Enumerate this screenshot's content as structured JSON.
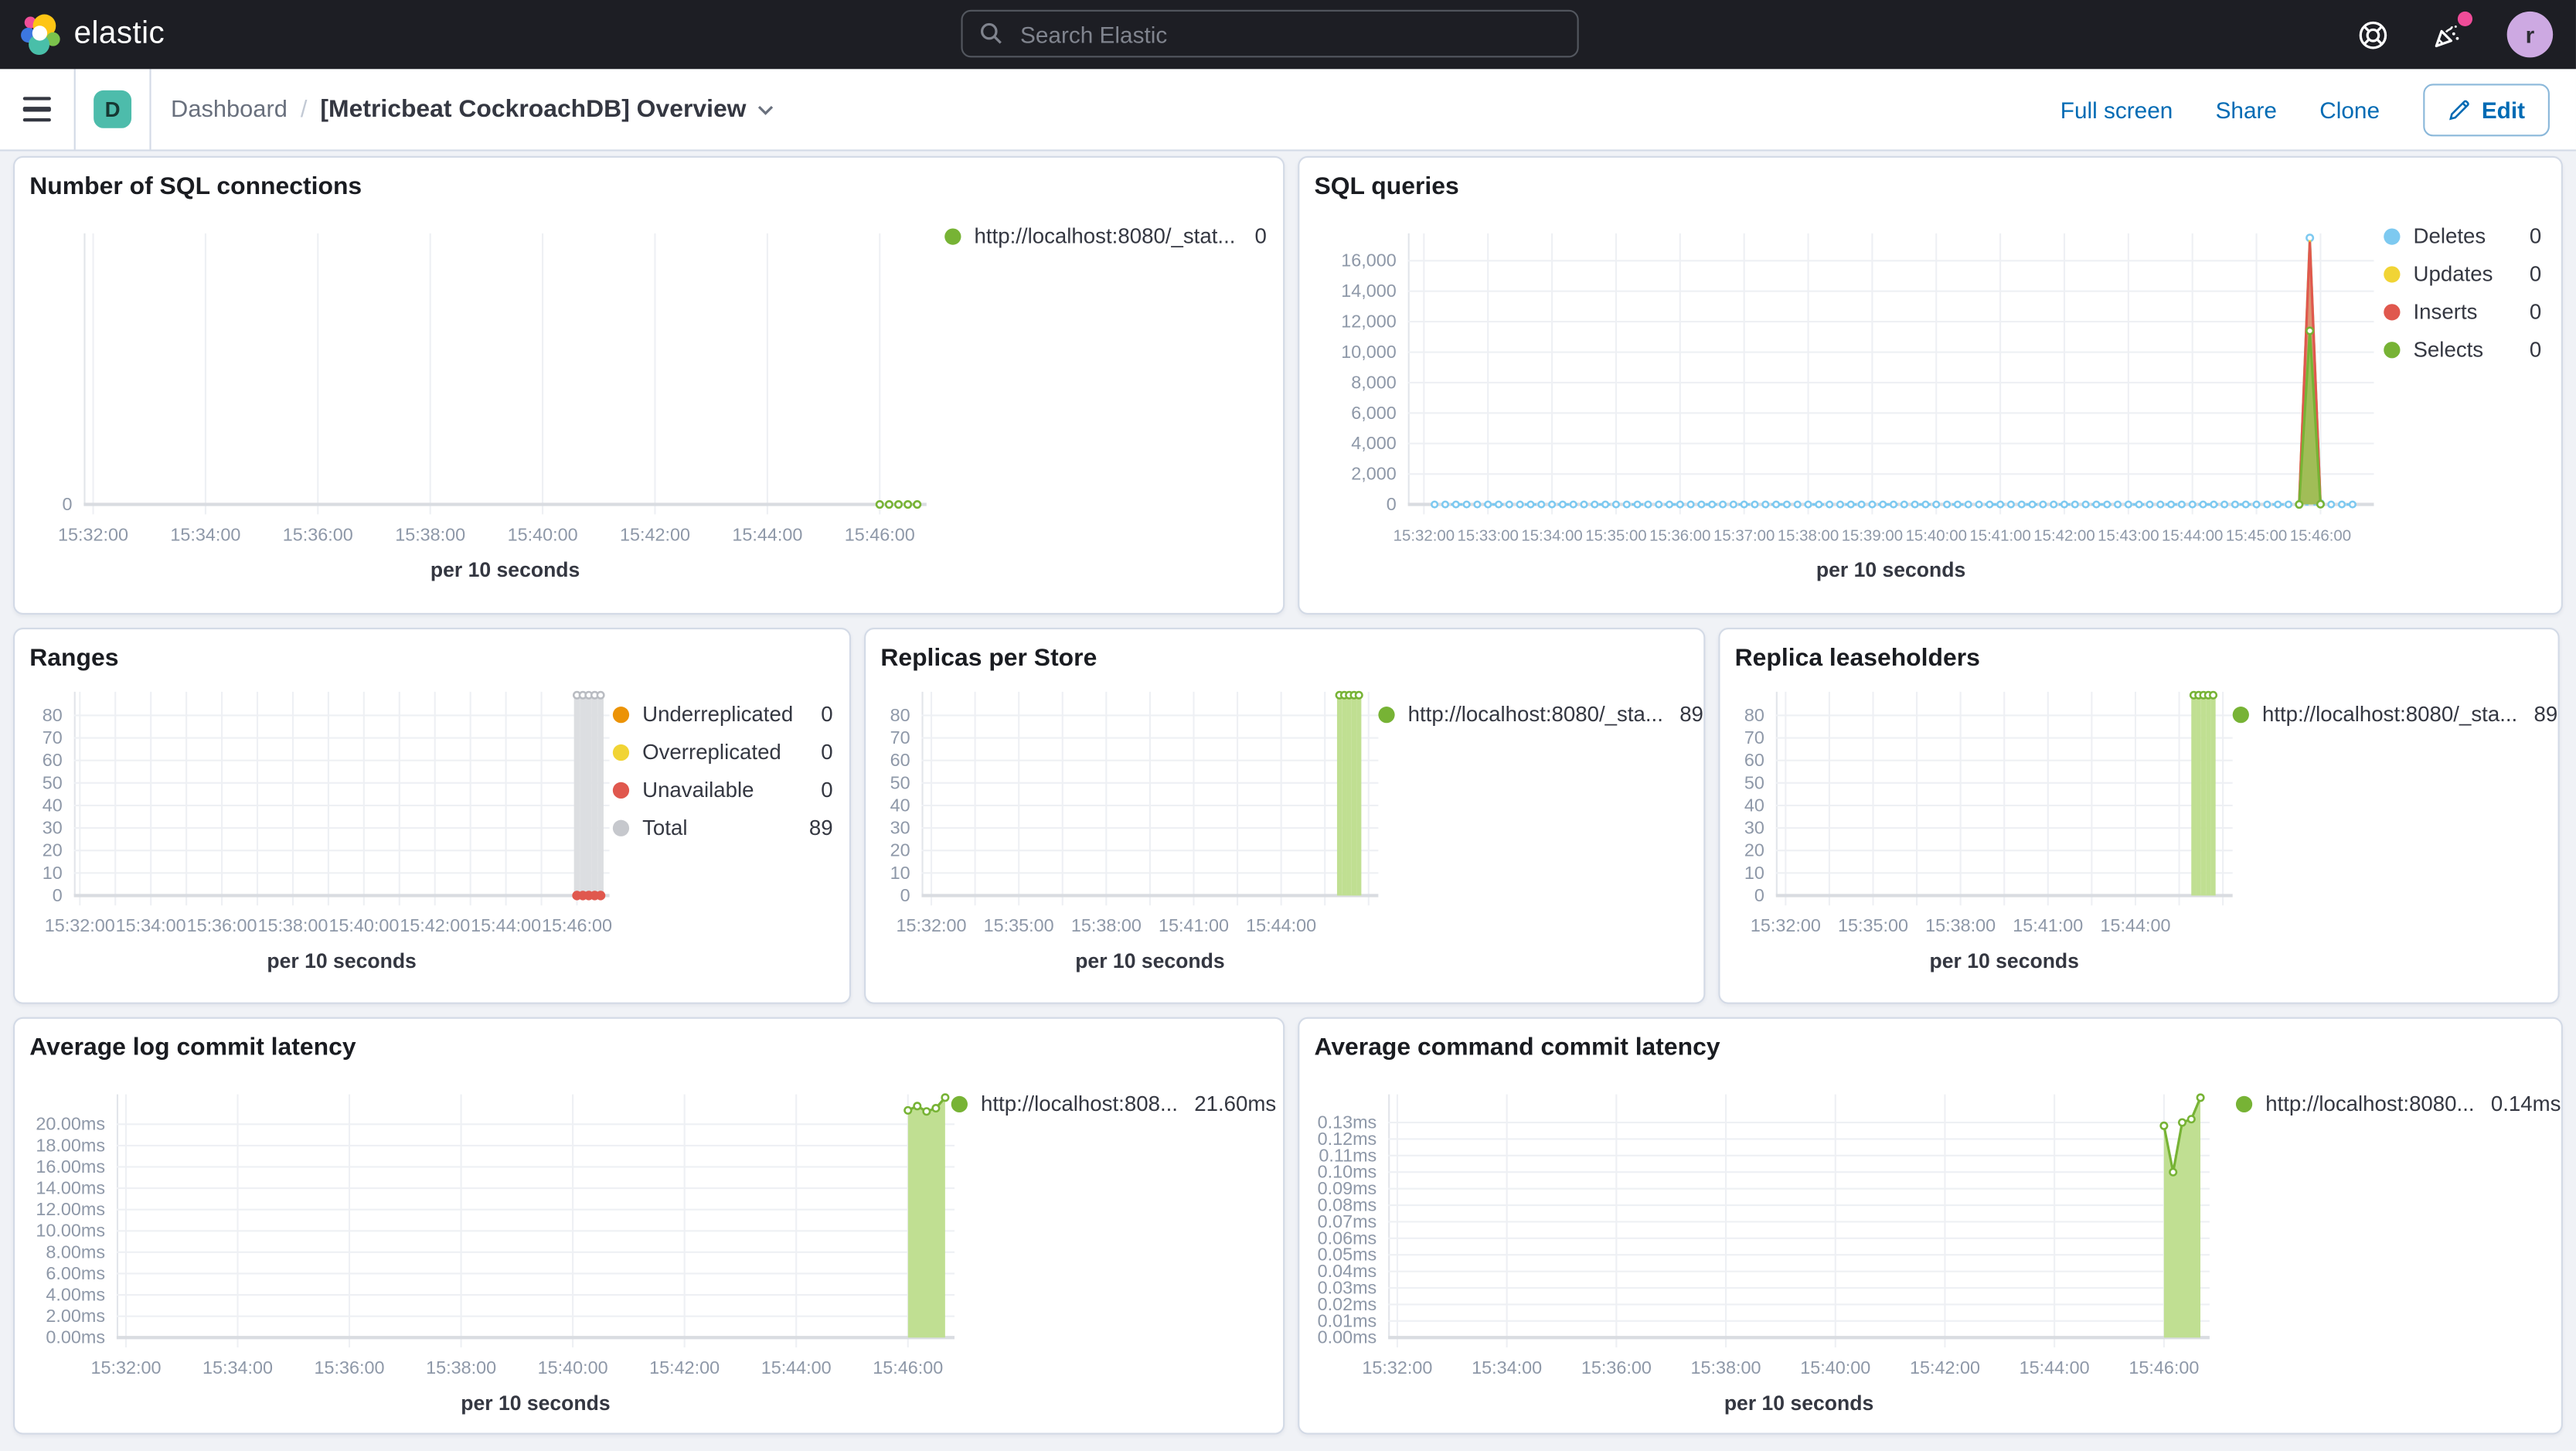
{
  "header": {
    "brand": "elastic",
    "search_placeholder": "Search Elastic",
    "avatar_initial": "r"
  },
  "toolbar": {
    "breadcrumb_root": "Dashboard",
    "breadcrumb_sep": "/",
    "title": "[Metricbeat CockroachDB] Overview",
    "fullscreen": "Full screen",
    "share": "Share",
    "clone": "Clone",
    "edit": "Edit"
  },
  "colors": {
    "green": "#77b335",
    "green_fill": "#c0df92",
    "blue": "#7dc9f0",
    "yellow": "#f1d435",
    "red": "#e0584e",
    "orange": "#ec9306",
    "gray": "#c6c8cd",
    "accent_blue": "#006bb4"
  },
  "chart_data": [
    {
      "title": "Number of SQL connections",
      "type": "line",
      "xlabel": "per 10 seconds",
      "x_domain": [
        "15:31:50",
        "15:46:50"
      ],
      "x_ticks": [
        "15:32:00",
        "15:34:00",
        "15:36:00",
        "15:38:00",
        "15:40:00",
        "15:42:00",
        "15:44:00",
        "15:46:00"
      ],
      "x_minor": 1,
      "ylim": [
        0,
        1
      ],
      "y_ticks": [
        {
          "label": "0",
          "value": 0
        }
      ],
      "legend": [
        {
          "label": "http://localhost:8080/_stat...",
          "value": "0",
          "color": "#77b335"
        }
      ],
      "series": [
        {
          "name": "connections",
          "kind": "line",
          "stroke": "#77b335",
          "dashed": true,
          "marker": "open",
          "r": 2.0,
          "ranges": [
            [
              "15:46:00",
              "15:46:40",
              10,
              0
            ]
          ]
        }
      ]
    },
    {
      "title": "SQL queries",
      "type": "area",
      "xlabel": "per 10 seconds",
      "x_domain": [
        "15:31:45",
        "15:46:50"
      ],
      "x_ticks": [
        "15:32:00",
        "15:33:00",
        "15:34:00",
        "15:35:00",
        "15:36:00",
        "15:37:00",
        "15:38:00",
        "15:39:00",
        "15:40:00",
        "15:41:00",
        "15:42:00",
        "15:43:00",
        "15:44:00",
        "15:45:00",
        "15:46:00"
      ],
      "x_minor": 1,
      "tick_small": true,
      "ylim": [
        0,
        17800
      ],
      "y_ticks": [
        {
          "label": "0",
          "value": 0
        },
        {
          "label": "2,000",
          "value": 2000
        },
        {
          "label": "4,000",
          "value": 4000
        },
        {
          "label": "6,000",
          "value": 6000
        },
        {
          "label": "8,000",
          "value": 8000
        },
        {
          "label": "10,000",
          "value": 10000
        },
        {
          "label": "12,000",
          "value": 12000
        },
        {
          "label": "14,000",
          "value": 14000
        },
        {
          "label": "16,000",
          "value": 16000
        }
      ],
      "legend": [
        {
          "label": "Deletes",
          "value": "0",
          "color": "#7dc9f0"
        },
        {
          "label": "Updates",
          "value": "0",
          "color": "#f1d435"
        },
        {
          "label": "Inserts",
          "value": "0",
          "color": "#e0584e"
        },
        {
          "label": "Selects",
          "value": "0",
          "color": "#77b335"
        }
      ],
      "series": [
        {
          "name": "Deletes-flat",
          "kind": "line",
          "stroke": "#7dc9f0",
          "dashed": true,
          "marker": "open",
          "r": 1.8,
          "ranges": [
            [
              "15:32:10",
              "15:45:40",
              10,
              0
            ],
            [
              "15:46:00",
              "15:46:30",
              10,
              0
            ]
          ]
        },
        {
          "name": "Deletes-spike",
          "kind": "area",
          "stroke": "#7dc9f0",
          "fill": "rgba(125,201,240,0.45)",
          "marker": "open",
          "r": 2.0,
          "points": [
            [
              "15:45:40",
              0
            ],
            [
              "15:45:50",
              17500
            ],
            [
              "15:46:00",
              60
            ]
          ]
        },
        {
          "name": "Updates-spike",
          "kind": "area",
          "stroke": "#f1d435",
          "fill": "rgba(241,212,53,0.45)",
          "points": [
            [
              "15:45:40",
              0
            ],
            [
              "15:45:50",
              17350
            ],
            [
              "15:46:00",
              45
            ]
          ]
        },
        {
          "name": "Inserts-spike",
          "kind": "area",
          "stroke": "#e0584e",
          "fill": "rgba(224,88,78,0.55)",
          "points": [
            [
              "15:45:40",
              0
            ],
            [
              "15:45:50",
              17250
            ],
            [
              "15:46:00",
              30
            ]
          ]
        },
        {
          "name": "Selects-spike",
          "kind": "area",
          "stroke": "#77b335",
          "fill": "rgba(150,196,82,0.85)",
          "marker": "open",
          "r": 2.0,
          "points": [
            [
              "15:45:40",
              0
            ],
            [
              "15:45:50",
              11400
            ],
            [
              "15:46:00",
              15
            ]
          ]
        }
      ]
    },
    {
      "title": "Ranges",
      "type": "bar",
      "xlabel": "per 10 seconds",
      "x_domain": [
        "15:31:50",
        "15:46:55"
      ],
      "x_ticks": [
        "15:32:00",
        "15:34:00",
        "15:36:00",
        "15:38:00",
        "15:40:00",
        "15:42:00",
        "15:44:00",
        "15:46:00"
      ],
      "x_minor": 2,
      "ylim": [
        0,
        90.5
      ],
      "y_ticks": [
        {
          "label": "0",
          "value": 0
        },
        {
          "label": "10",
          "value": 10
        },
        {
          "label": "20",
          "value": 20
        },
        {
          "label": "30",
          "value": 30
        },
        {
          "label": "40",
          "value": 40
        },
        {
          "label": "50",
          "value": 50
        },
        {
          "label": "60",
          "value": 60
        },
        {
          "label": "70",
          "value": 70
        },
        {
          "label": "80",
          "value": 80
        }
      ],
      "legend": [
        {
          "label": "Underreplicated",
          "value": "0",
          "color": "#ec9306"
        },
        {
          "label": "Overreplicated",
          "value": "0",
          "color": "#f1d435"
        },
        {
          "label": "Unavailable",
          "value": "0",
          "color": "#e0584e"
        },
        {
          "label": "Total",
          "value": "89",
          "color": "#c6c8cd"
        }
      ],
      "series": [
        {
          "name": "Total",
          "kind": "bar",
          "stroke": "#b9bcc2",
          "fill": "#dcdee1",
          "marker": "open",
          "r": 2.0,
          "bar_w_s": 10,
          "ranges": [
            [
              "15:46:00",
              "15:46:40",
              10,
              89
            ]
          ]
        },
        {
          "name": "Unavailable",
          "kind": "line",
          "stroke": "#e0584e",
          "marker": "filled",
          "r": 2.3,
          "ranges": [
            [
              "15:46:00",
              "15:46:40",
              10,
              0
            ]
          ]
        }
      ]
    },
    {
      "title": "Replicas per Store",
      "type": "bar",
      "xlabel": "per 10 seconds",
      "x_domain": [
        "15:31:40",
        "15:47:20"
      ],
      "x_ticks": [
        "15:32:00",
        "15:35:00",
        "15:38:00",
        "15:41:00",
        "15:44:00"
      ],
      "x_minor": 2,
      "ylim": [
        0,
        90.5
      ],
      "y_ticks": [
        {
          "label": "0",
          "value": 0
        },
        {
          "label": "10",
          "value": 10
        },
        {
          "label": "20",
          "value": 20
        },
        {
          "label": "30",
          "value": 30
        },
        {
          "label": "40",
          "value": 40
        },
        {
          "label": "50",
          "value": 50
        },
        {
          "label": "60",
          "value": 60
        },
        {
          "label": "70",
          "value": 70
        },
        {
          "label": "80",
          "value": 80
        }
      ],
      "legend": [
        {
          "label": "http://localhost:8080/_sta...",
          "value": "89",
          "color": "#77b335"
        }
      ],
      "series": [
        {
          "name": "replicas",
          "kind": "bar",
          "stroke": "#77b335",
          "fill": "#c0df92",
          "marker": "open",
          "r": 2.0,
          "bar_w_s": 10,
          "ranges": [
            [
              "15:46:00",
              "15:46:40",
              10,
              89
            ]
          ]
        }
      ]
    },
    {
      "title": "Replica leaseholders",
      "type": "bar",
      "xlabel": "per 10 seconds",
      "x_domain": [
        "15:31:40",
        "15:47:20"
      ],
      "x_ticks": [
        "15:32:00",
        "15:35:00",
        "15:38:00",
        "15:41:00",
        "15:44:00"
      ],
      "x_minor": 2,
      "ylim": [
        0,
        90.5
      ],
      "y_ticks": [
        {
          "label": "0",
          "value": 0
        },
        {
          "label": "10",
          "value": 10
        },
        {
          "label": "20",
          "value": 20
        },
        {
          "label": "30",
          "value": 30
        },
        {
          "label": "40",
          "value": 40
        },
        {
          "label": "50",
          "value": 50
        },
        {
          "label": "60",
          "value": 60
        },
        {
          "label": "70",
          "value": 70
        },
        {
          "label": "80",
          "value": 80
        }
      ],
      "legend": [
        {
          "label": "http://localhost:8080/_sta...",
          "value": "89",
          "color": "#77b335"
        }
      ],
      "series": [
        {
          "name": "leaseholders",
          "kind": "bar",
          "stroke": "#77b335",
          "fill": "#c0df92",
          "marker": "open",
          "r": 2.0,
          "bar_w_s": 10,
          "ranges": [
            [
              "15:46:00",
              "15:46:40",
              10,
              89
            ]
          ]
        }
      ]
    },
    {
      "title": "Average log commit latency",
      "type": "area",
      "xlabel": "per 10 seconds",
      "x_domain": [
        "15:31:50",
        "15:46:50"
      ],
      "x_ticks": [
        "15:32:00",
        "15:34:00",
        "15:36:00",
        "15:38:00",
        "15:40:00",
        "15:42:00",
        "15:44:00",
        "15:46:00"
      ],
      "x_minor": 1,
      "ylim": [
        0,
        22.8
      ],
      "y_ticks": [
        {
          "label": "0.00ms",
          "value": 0
        },
        {
          "label": "2.00ms",
          "value": 2
        },
        {
          "label": "4.00ms",
          "value": 4
        },
        {
          "label": "6.00ms",
          "value": 6
        },
        {
          "label": "8.00ms",
          "value": 8
        },
        {
          "label": "10.00ms",
          "value": 10
        },
        {
          "label": "12.00ms",
          "value": 12
        },
        {
          "label": "14.00ms",
          "value": 14
        },
        {
          "label": "16.00ms",
          "value": 16
        },
        {
          "label": "18.00ms",
          "value": 18
        },
        {
          "label": "20.00ms",
          "value": 20
        }
      ],
      "legend": [
        {
          "label": "http://localhost:808...",
          "value": "21.60ms",
          "color": "#77b335"
        }
      ],
      "series": [
        {
          "name": "log-commit-latency",
          "kind": "area",
          "stroke": "#77b335",
          "fill": "#c0df92",
          "marker": "open",
          "r": 2.0,
          "points": [
            [
              "15:46:00",
              21.3
            ],
            [
              "15:46:10",
              21.7
            ],
            [
              "15:46:20",
              21.2
            ],
            [
              "15:46:30",
              21.5
            ],
            [
              "15:46:40",
              22.5
            ]
          ]
        }
      ]
    },
    {
      "title": "Average command commit latency",
      "type": "area",
      "xlabel": "per 10 seconds",
      "x_domain": [
        "15:31:50",
        "15:46:50"
      ],
      "x_ticks": [
        "15:32:00",
        "15:34:00",
        "15:36:00",
        "15:38:00",
        "15:40:00",
        "15:42:00",
        "15:44:00",
        "15:46:00"
      ],
      "x_minor": 1,
      "ylim": [
        0,
        0.147
      ],
      "y_ticks": [
        {
          "label": "0.00ms",
          "value": 0
        },
        {
          "label": "0.01ms",
          "value": 0.01
        },
        {
          "label": "0.02ms",
          "value": 0.02
        },
        {
          "label": "0.03ms",
          "value": 0.03
        },
        {
          "label": "0.04ms",
          "value": 0.04
        },
        {
          "label": "0.05ms",
          "value": 0.05
        },
        {
          "label": "0.06ms",
          "value": 0.06
        },
        {
          "label": "0.07ms",
          "value": 0.07
        },
        {
          "label": "0.08ms",
          "value": 0.08
        },
        {
          "label": "0.09ms",
          "value": 0.09
        },
        {
          "label": "0.10ms",
          "value": 0.1
        },
        {
          "label": "0.11ms",
          "value": 0.11
        },
        {
          "label": "0.12ms",
          "value": 0.12
        },
        {
          "label": "0.13ms",
          "value": 0.13
        }
      ],
      "legend": [
        {
          "label": "http://localhost:8080...",
          "value": "0.14ms",
          "color": "#77b335"
        }
      ],
      "series": [
        {
          "name": "command-commit-latency",
          "kind": "area",
          "stroke": "#77b335",
          "fill": "#c0df92",
          "marker": "open",
          "r": 2.0,
          "points": [
            [
              "15:46:00",
              0.128
            ],
            [
              "15:46:10",
              0.1
            ],
            [
              "15:46:20",
              0.13
            ],
            [
              "15:46:30",
              0.132
            ],
            [
              "15:46:40",
              0.145
            ]
          ]
        }
      ]
    }
  ]
}
